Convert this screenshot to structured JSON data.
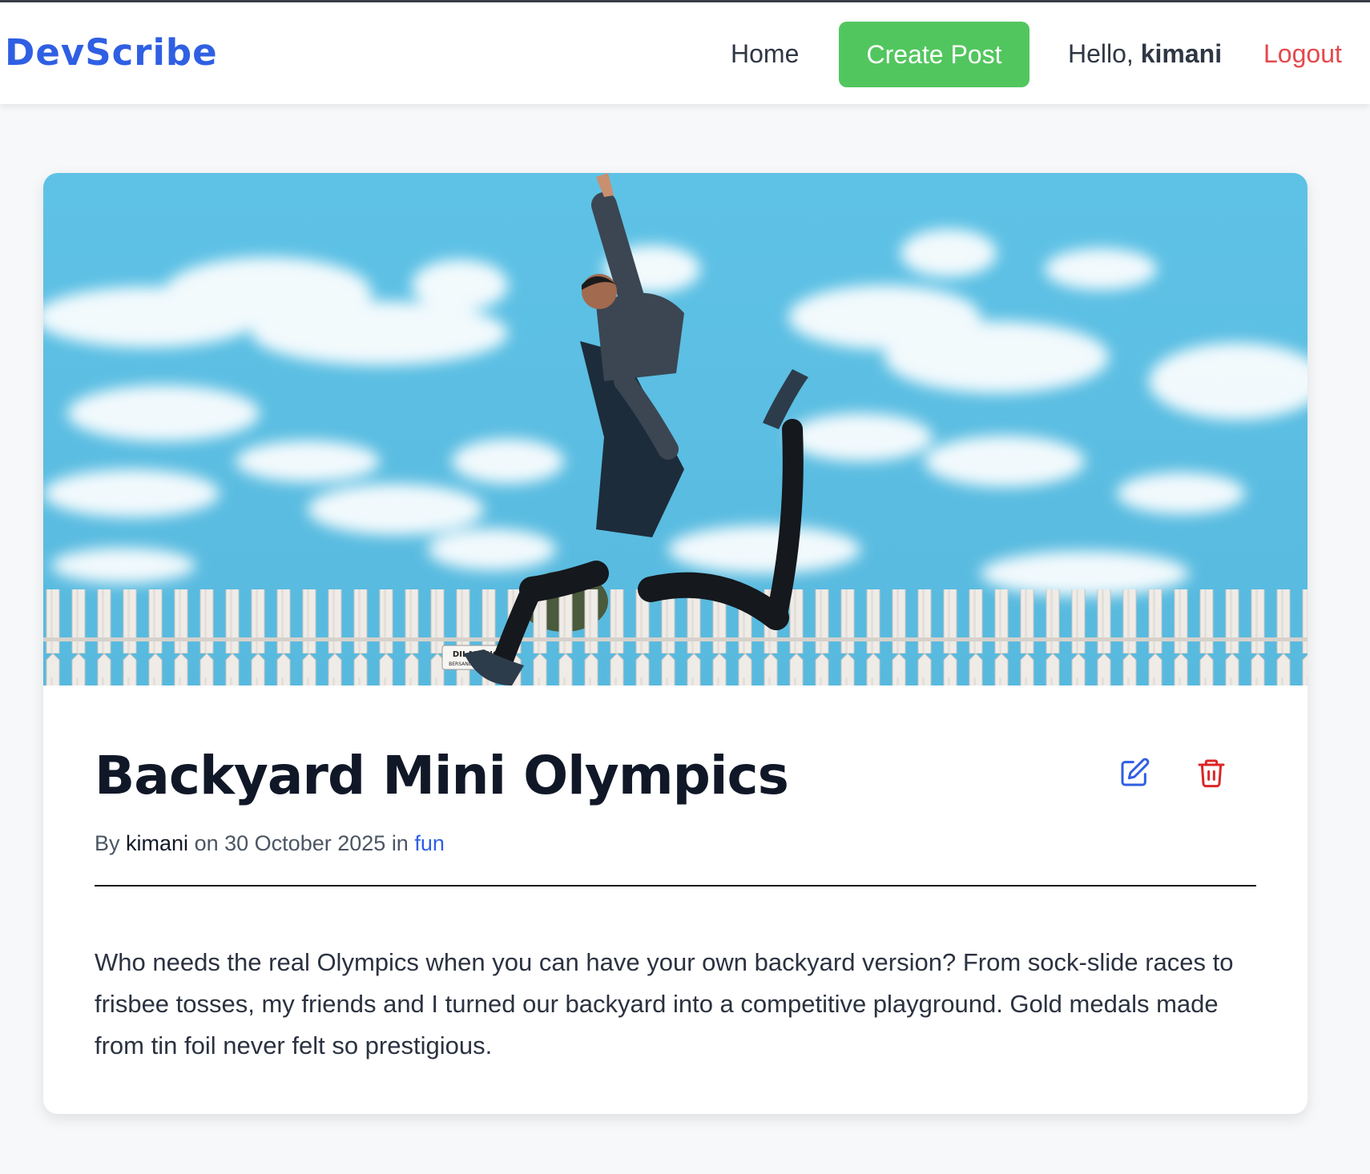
{
  "navbar": {
    "brand": "DevScribe",
    "home": "Home",
    "create_post": "Create Post",
    "greeting": "Hello,",
    "username": "kimani",
    "logout": "Logout"
  },
  "post": {
    "title": "Backyard Mini Olympics",
    "meta": {
      "by": "By",
      "author": "kimani",
      "on": "on",
      "date": "30 October 2025",
      "in": "in",
      "category": "fun"
    },
    "image_sign_text": [
      "DILARANG",
      "BERSANDAR DI PAGAR"
    ],
    "content": "Who needs the real Olympics when you can have your own backyard version? From sock-slide races to frisbee tosses, my friends and I turned our backyard into a competitive playground. Gold medals made from tin foil never felt so prestigious.",
    "edit_icon": "edit-icon",
    "delete_icon": "trash-icon"
  },
  "colors": {
    "brand": "#2f5fe3",
    "create_button": "#52c65e",
    "logout": "#e5484d",
    "edit_icon": "#2f5fe3",
    "delete_icon": "#dc2626",
    "sky": "#5bbfe3"
  }
}
